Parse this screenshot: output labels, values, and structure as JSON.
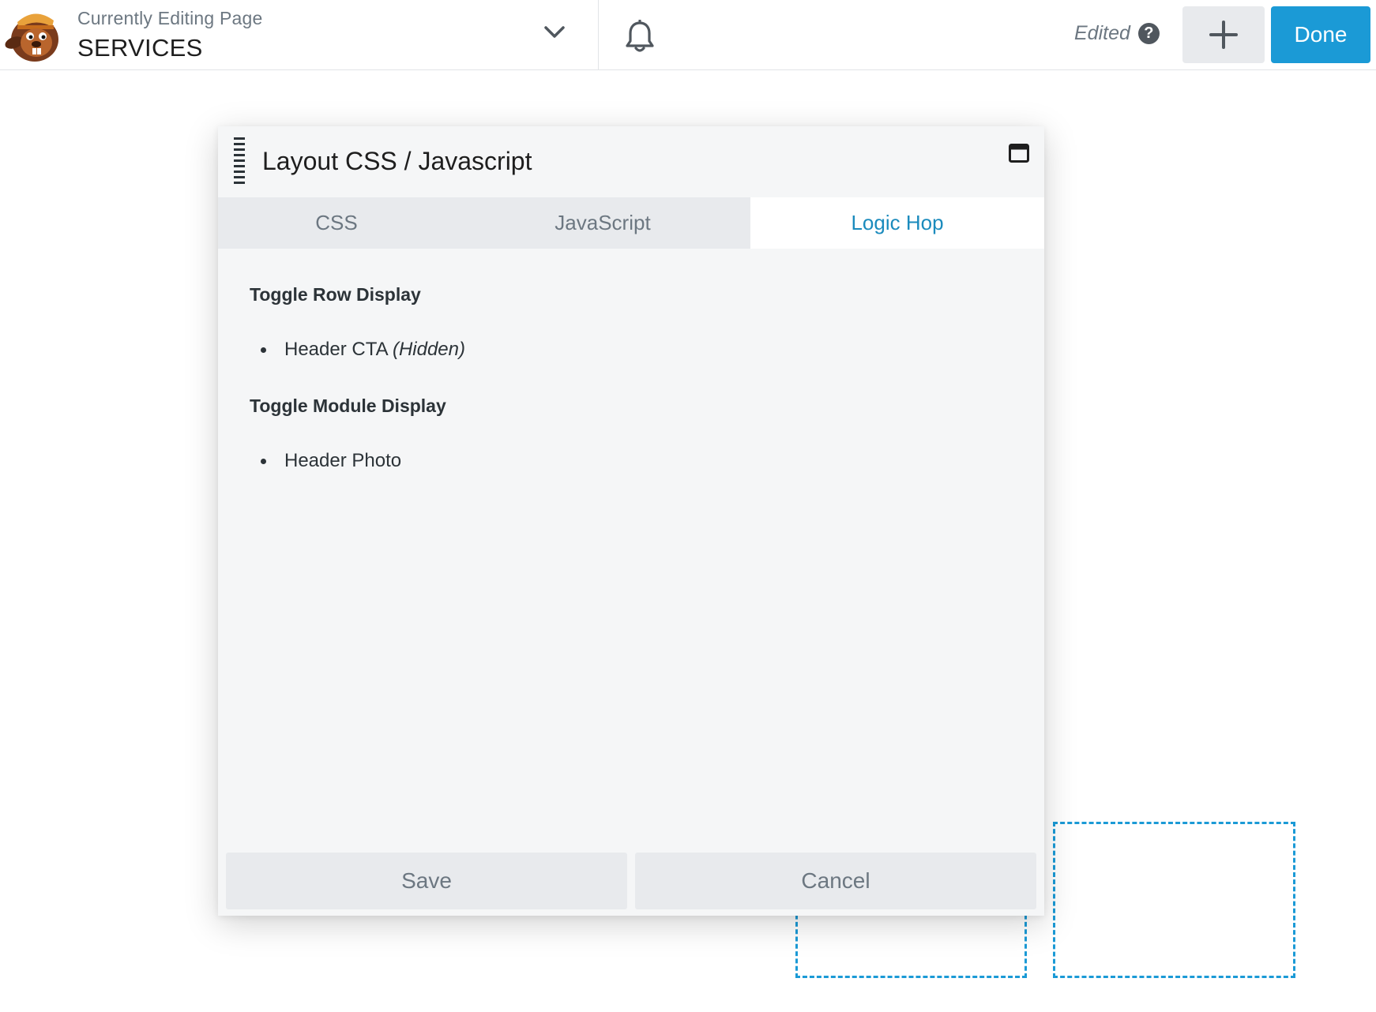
{
  "header": {
    "subtitle": "Currently Editing Page",
    "page_name": "SERVICES",
    "status": "Edited",
    "help_glyph": "?",
    "done_label": "Done"
  },
  "icons": {
    "logo": "beaver-logo",
    "dropdown": "chevron-down-icon",
    "notifications": "bell-icon",
    "help": "question-circle-icon",
    "add": "plus-icon",
    "drag": "drag-handle-icon",
    "maximize": "window-maximize-icon"
  },
  "colors": {
    "accent": "#1b9ad6",
    "active_tab_text": "#1b8bbd",
    "panel_bg": "#f5f6f7",
    "tab_bg": "#e8eaed"
  },
  "panel": {
    "title": "Layout CSS / Javascript",
    "tabs": [
      {
        "label": "CSS"
      },
      {
        "label": "JavaScript"
      },
      {
        "label": "Logic Hop",
        "active": true
      }
    ],
    "sections": [
      {
        "heading": "Toggle Row Display",
        "items": [
          {
            "text": "Header CTA",
            "note": "(Hidden)"
          }
        ]
      },
      {
        "heading": "Toggle Module Display",
        "items": [
          {
            "text": "Header Photo"
          }
        ]
      }
    ],
    "save_label": "Save",
    "cancel_label": "Cancel"
  }
}
